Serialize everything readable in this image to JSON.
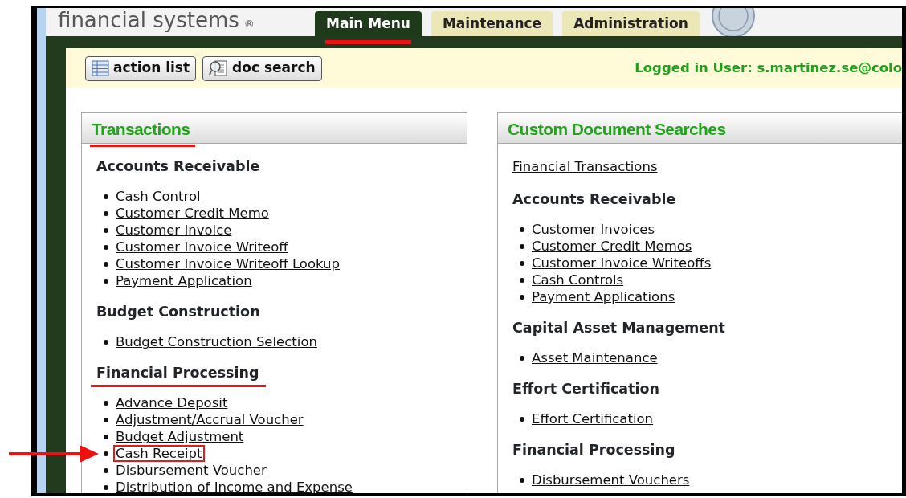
{
  "header": {
    "logo": "financial systems",
    "logo_mark": "®",
    "tabs": [
      {
        "label": "Main Menu",
        "selected": true,
        "annotated": true
      },
      {
        "label": "Maintenance",
        "selected": false,
        "annotated": false
      },
      {
        "label": "Administration",
        "selected": false,
        "annotated": false
      }
    ]
  },
  "toolbar": {
    "buttons": [
      {
        "label": "action list",
        "kind": "list"
      },
      {
        "label": "doc search",
        "kind": "search"
      }
    ],
    "user": "Logged in User: s.martinez.se@colo"
  },
  "panels": [
    {
      "title": "Transactions",
      "annotated": true,
      "sections": [
        {
          "heading": "Accounts Receivable",
          "annotated": false,
          "links": [
            {
              "label": "Cash Control",
              "highlighted": false
            },
            {
              "label": "Customer Credit Memo",
              "highlighted": false
            },
            {
              "label": "Customer Invoice",
              "highlighted": false
            },
            {
              "label": "Customer Invoice Writeoff",
              "highlighted": false
            },
            {
              "label": "Customer Invoice Writeoff Lookup",
              "highlighted": false
            },
            {
              "label": "Payment Application",
              "highlighted": false
            }
          ]
        },
        {
          "heading": "Budget Construction",
          "annotated": false,
          "links": [
            {
              "label": "Budget Construction Selection",
              "highlighted": false
            }
          ]
        },
        {
          "heading": "Financial Processing",
          "annotated": true,
          "links": [
            {
              "label": "Advance Deposit",
              "highlighted": false
            },
            {
              "label": "Adjustment/Accrual Voucher",
              "highlighted": false
            },
            {
              "label": "Budget Adjustment",
              "highlighted": false
            },
            {
              "label": "Cash Receipt",
              "highlighted": true
            },
            {
              "label": "Disbursement Voucher",
              "highlighted": false
            },
            {
              "label": "Distribution of Income and Expense",
              "highlighted": false
            }
          ]
        }
      ]
    },
    {
      "title": "Custom Document Searches",
      "annotated": false,
      "top_link": "Financial Transactions",
      "sections": [
        {
          "heading": "Accounts Receivable",
          "annotated": false,
          "links": [
            {
              "label": "Customer Invoices",
              "highlighted": false
            },
            {
              "label": "Customer Credit Memos",
              "highlighted": false
            },
            {
              "label": "Customer Invoice Writeoffs",
              "highlighted": false
            },
            {
              "label": "Cash Controls",
              "highlighted": false
            },
            {
              "label": "Payment Applications",
              "highlighted": false
            }
          ]
        },
        {
          "heading": "Capital Asset Management",
          "annotated": false,
          "links": [
            {
              "label": "Asset Maintenance",
              "highlighted": false
            }
          ]
        },
        {
          "heading": "Effort Certification",
          "annotated": false,
          "links": [
            {
              "label": "Effort Certification",
              "highlighted": false
            }
          ]
        },
        {
          "heading": "Financial Processing",
          "annotated": false,
          "links": [
            {
              "label": "Disbursement Vouchers",
              "highlighted": false
            }
          ]
        }
      ]
    }
  ]
}
